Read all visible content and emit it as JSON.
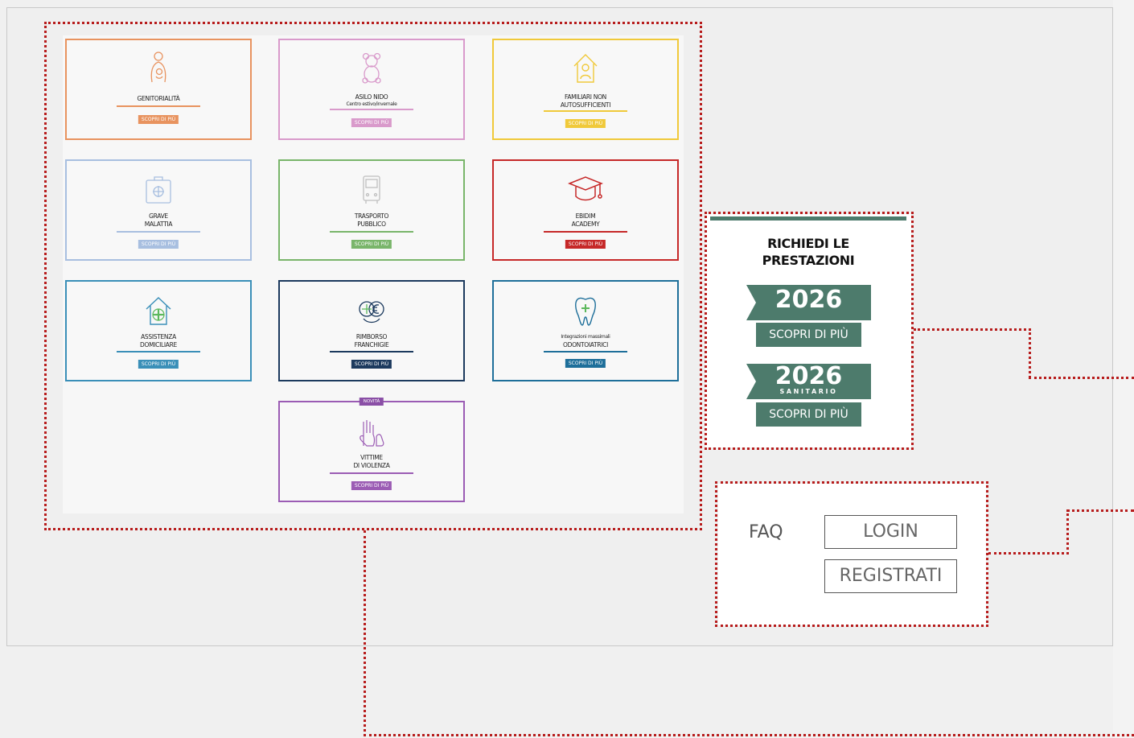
{
  "cards": [
    {
      "title1": "GENITORIALITÀ",
      "title2": "",
      "button": "SCOPRI DI PIÙ",
      "color": "#e8935f",
      "icon": "parent-child-icon"
    },
    {
      "title1": "ASILO NIDO",
      "title2": "Centro estivo/invernale",
      "button": "SCOPRI DI PIÙ",
      "color": "#d99acb",
      "icon": "teddy-bear-icon"
    },
    {
      "title1": "FAMILIARI NON",
      "title2": "AUTOSUFFICIENTI",
      "button": "SCOPRI DI PIÙ",
      "color": "#f0c93a",
      "icon": "house-person-icon"
    },
    {
      "title1": "GRAVE",
      "title2": "MALATTIA",
      "button": "SCOPRI DI PIÙ",
      "color": "#a8bfe0",
      "icon": "medical-kit-icon"
    },
    {
      "title1": "TRASPORTO",
      "title2": "PUBBLICO",
      "button": "SCOPRI DI PIÙ",
      "color": "#79b56a",
      "icon": "bus-icon"
    },
    {
      "title1": "EBIDIM",
      "title2": "ACADEMY",
      "button": "SCOPRI DI PIÙ",
      "color": "#c62828",
      "icon": "graduation-cap-icon"
    },
    {
      "title1": "ASSISTENZA",
      "title2": "DOMICILIARE",
      "button": "SCOPRI DI PIÙ",
      "color": "#3a8fb8",
      "icon": "home-care-icon"
    },
    {
      "title1": "RIMBORSO",
      "title2": "FRANCHIGIE",
      "button": "SCOPRI DI PIÙ",
      "color": "#1c3a5e",
      "icon": "euro-refund-icon"
    },
    {
      "title1": "Integrazioni massimali",
      "title2": "ODONTOIATRICI",
      "button": "SCOPRI DI PIÙ",
      "color": "#1e6f9a",
      "icon": "tooth-icon"
    },
    {
      "title1": "VITTIME",
      "title2": "DI VIOLENZA",
      "button": "SCOPRI DI PIÙ",
      "color": "#9b5cb4",
      "icon": "stop-hand-icon",
      "badge": "NOVITÀ"
    }
  ],
  "richiedi": {
    "line1": "RICHIEDI LE",
    "line2": "PRESTAZIONI",
    "year1": "2026",
    "year2": "2026",
    "year2_sub": "SANITARIO",
    "button1": "SCOPRI DI PIÙ",
    "button2": "SCOPRI DI PIÙ",
    "color": "#4d7b6c"
  },
  "auth": {
    "faq": "FAQ",
    "login": "LOGIN",
    "register": "REGISTRATI"
  },
  "annotation_color": "#b71c1c"
}
